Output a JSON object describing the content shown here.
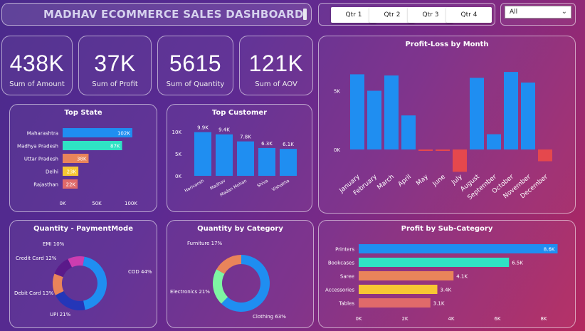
{
  "header": {
    "title": "MADHAV ECOMMERCE SALES DASHBOARD"
  },
  "quarters": [
    "Qtr 1",
    "Qtr 2",
    "Qtr 3",
    "Qtr 4"
  ],
  "slicer": {
    "selected": "All"
  },
  "kpis": [
    {
      "value": "438K",
      "label": "Sum of Amount"
    },
    {
      "value": "37K",
      "label": "Sum of Profit"
    },
    {
      "value": "5615",
      "label": "Sum of Quantity"
    },
    {
      "value": "121K",
      "label": "Sum of AOV"
    }
  ],
  "colors": {
    "blue": "#1f8ef1",
    "teal": "#2fe3c4",
    "orange": "#e9845a",
    "yellow": "#f7c733",
    "rose": "#e06a6a",
    "red": "#e5484d",
    "magenta": "#cc3db0",
    "navy": "#2436b8",
    "purple": "#5a1a8a",
    "green": "#7ef5a3"
  },
  "chart_data": [
    {
      "id": "top-state",
      "type": "bar",
      "orientation": "horizontal",
      "title": "Top State",
      "categories": [
        "Maharashtra",
        "Madhya Pradesh",
        "Uttar Pradesh",
        "Delhi",
        "Rajasthan"
      ],
      "values": [
        102,
        87,
        38,
        23,
        22
      ],
      "value_labels": [
        "102K",
        "87K",
        "38K",
        "23K",
        "22K"
      ],
      "colors": [
        "#1f8ef1",
        "#2fe3c4",
        "#e9845a",
        "#f7c733",
        "#e06a6a"
      ],
      "xticks": [
        "0K",
        "50K",
        "100K"
      ],
      "xlim": [
        0,
        100
      ]
    },
    {
      "id": "top-customer",
      "type": "bar",
      "title": "Top Customer",
      "categories": [
        "Harivansh",
        "Madhav",
        "Madan Mohan",
        "Shiva",
        "Vishakha"
      ],
      "values": [
        9.9,
        9.4,
        7.8,
        6.3,
        6.1
      ],
      "value_labels": [
        "9.9K",
        "9.4K",
        "7.8K",
        "6.3K",
        "6.1K"
      ],
      "yticks": [
        "0K",
        "5K",
        "10K"
      ],
      "ylim": [
        0,
        10
      ]
    },
    {
      "id": "profit-loss",
      "type": "bar",
      "title": "Profit-Loss by Month",
      "categories": [
        "January",
        "February",
        "March",
        "April",
        "May",
        "June",
        "July",
        "August",
        "September",
        "October",
        "November",
        "December"
      ],
      "values": [
        6.4,
        5.0,
        6.3,
        2.9,
        -0.1,
        -0.1,
        -1.9,
        6.1,
        1.3,
        6.6,
        5.7,
        -1.0
      ],
      "yticks": [
        "0K",
        "5K"
      ],
      "ylim": [
        -2,
        7.5
      ]
    },
    {
      "id": "payment-mode",
      "type": "pie",
      "donut": true,
      "title": "Quantity - PaymentMode",
      "labels": [
        "COD",
        "UPI",
        "Debit Card",
        "Credit Card",
        "EMI"
      ],
      "values": [
        44,
        21,
        13,
        12,
        10
      ],
      "display": [
        "COD 44%",
        "UPI 21%",
        "Debit Card 13%",
        "Credit Card 12%",
        "EMI 10%"
      ],
      "colors": [
        "#1f8ef1",
        "#2436b8",
        "#e9845a",
        "#5a1a8a",
        "#cc3db0"
      ]
    },
    {
      "id": "category",
      "type": "pie",
      "donut": true,
      "title": "Quantity by Category",
      "labels": [
        "Clothing",
        "Electronics",
        "Furniture"
      ],
      "values": [
        63,
        21,
        17
      ],
      "display": [
        "Clothing 63%",
        "Electronics 21%",
        "Furniture 17%"
      ],
      "colors": [
        "#1f8ef1",
        "#7ef5a3",
        "#e9845a"
      ]
    },
    {
      "id": "sub-category",
      "type": "bar",
      "orientation": "horizontal",
      "title": "Profit by Sub-Category",
      "categories": [
        "Printers",
        "Bookcases",
        "Saree",
        "Accessories",
        "Tables"
      ],
      "values": [
        8.6,
        6.5,
        4.1,
        3.4,
        3.1
      ],
      "value_labels": [
        "8.6K",
        "6.5K",
        "4.1K",
        "3.4K",
        "3.1K"
      ],
      "colors": [
        "#1f8ef1",
        "#2fe3c4",
        "#e9845a",
        "#f7c733",
        "#e06a6a"
      ],
      "xticks": [
        "0K",
        "2K",
        "4K",
        "6K",
        "8K"
      ],
      "xlim": [
        0,
        8
      ]
    }
  ]
}
